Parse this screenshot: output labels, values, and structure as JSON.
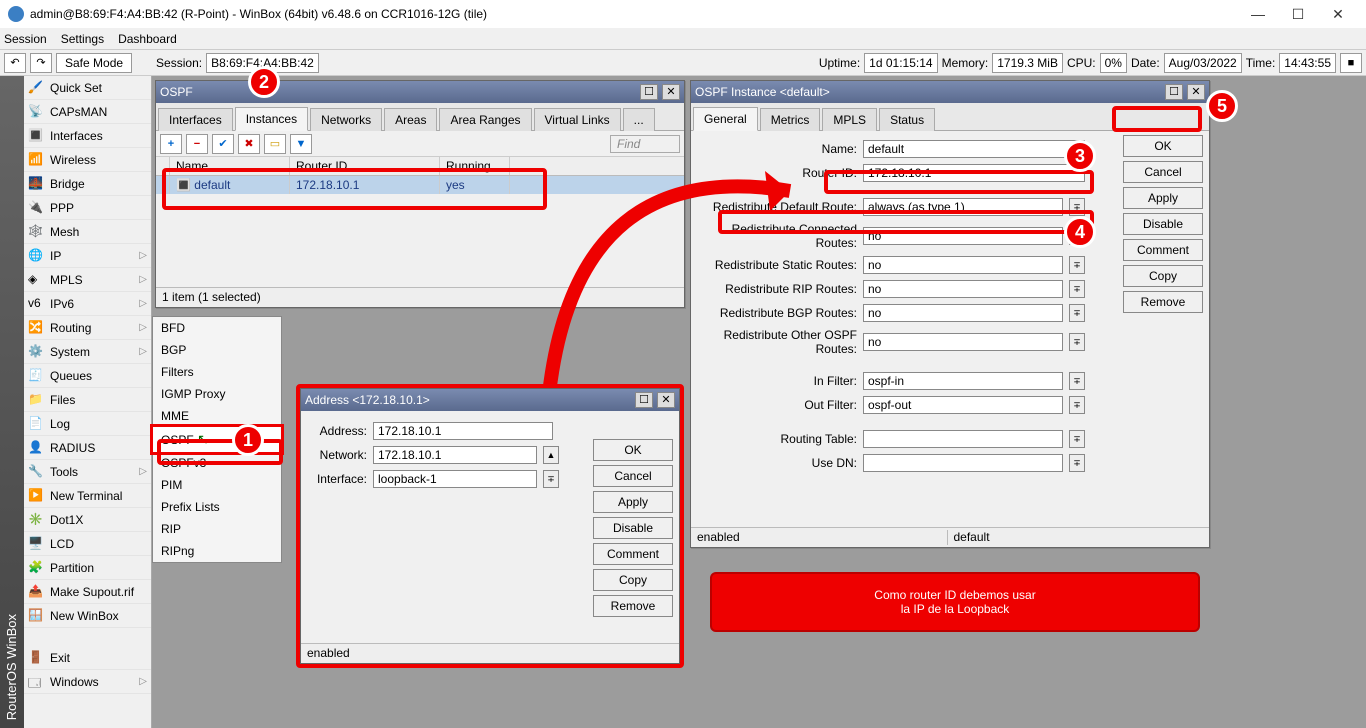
{
  "titlebar": {
    "title": "admin@B8:69:F4:A4:BB:42 (R-Point) - WinBox (64bit) v6.48.6 on CCR1016-12G (tile)"
  },
  "menubar": {
    "items": [
      "Session",
      "Settings",
      "Dashboard"
    ]
  },
  "toolbar": {
    "safe_mode": "Safe Mode",
    "session_label": "Session:",
    "session_value": "B8:69:F4:A4:BB:42",
    "uptime_label": "Uptime:",
    "uptime_value": "1d 01:15:14",
    "memory_label": "Memory:",
    "memory_value": "1719.3 MiB",
    "cpu_label": "CPU:",
    "cpu_value": "0%",
    "date_label": "Date:",
    "date_value": "Aug/03/2022",
    "time_label": "Time:",
    "time_value": "14:43:55"
  },
  "vbar_text": "RouterOS WinBox",
  "sidebar": {
    "items": [
      {
        "label": "Quick Set",
        "icon": "🖌️"
      },
      {
        "label": "CAPsMAN",
        "icon": "📡"
      },
      {
        "label": "Interfaces",
        "icon": "🔳"
      },
      {
        "label": "Wireless",
        "icon": "📶"
      },
      {
        "label": "Bridge",
        "icon": "🌉"
      },
      {
        "label": "PPP",
        "icon": "🔌"
      },
      {
        "label": "Mesh",
        "icon": "🕸️"
      },
      {
        "label": "IP",
        "icon": "🌐",
        "arrow": true
      },
      {
        "label": "MPLS",
        "icon": "◈",
        "arrow": true
      },
      {
        "label": "IPv6",
        "icon": "v6",
        "arrow": true
      },
      {
        "label": "Routing",
        "icon": "🔀",
        "arrow": true
      },
      {
        "label": "System",
        "icon": "⚙️",
        "arrow": true
      },
      {
        "label": "Queues",
        "icon": "🧾"
      },
      {
        "label": "Files",
        "icon": "📁"
      },
      {
        "label": "Log",
        "icon": "📄"
      },
      {
        "label": "RADIUS",
        "icon": "👤"
      },
      {
        "label": "Tools",
        "icon": "🔧",
        "arrow": true
      },
      {
        "label": "New Terminal",
        "icon": "▶️"
      },
      {
        "label": "Dot1X",
        "icon": "✳️"
      },
      {
        "label": "LCD",
        "icon": "🖥️"
      },
      {
        "label": "Partition",
        "icon": "🧩"
      },
      {
        "label": "Make Supout.rif",
        "icon": "📤"
      },
      {
        "label": "New WinBox",
        "icon": "🪟"
      },
      {
        "label": "Exit",
        "icon": "🚪"
      },
      {
        "label": "Windows",
        "icon": "🗔",
        "arrow": true
      }
    ]
  },
  "submenu": {
    "items": [
      "BFD",
      "BGP",
      "Filters",
      "IGMP Proxy",
      "MME",
      "OSPF",
      "OSPFv3",
      "PIM",
      "Prefix Lists",
      "RIP",
      "RIPng"
    ]
  },
  "ospf_window": {
    "title": "OSPF",
    "tabs": [
      "Interfaces",
      "Instances",
      "Networks",
      "Areas",
      "Area Ranges",
      "Virtual Links",
      "..."
    ],
    "find_placeholder": "Find",
    "columns": [
      "Name",
      "Router ID",
      "Running"
    ],
    "row": {
      "name": "default",
      "router_id": "172.18.10.1",
      "running": "yes"
    },
    "status": "1 item (1 selected)"
  },
  "addr_window": {
    "title": "Address <172.18.10.1>",
    "address_label": "Address:",
    "address_value": "172.18.10.1",
    "network_label": "Network:",
    "network_value": "172.18.10.1",
    "interface_label": "Interface:",
    "interface_value": "loopback-1",
    "buttons": [
      "OK",
      "Cancel",
      "Apply",
      "Disable",
      "Comment",
      "Copy",
      "Remove"
    ],
    "status": "enabled"
  },
  "instance_window": {
    "title": "OSPF Instance <default>",
    "tabs": [
      "General",
      "Metrics",
      "MPLS",
      "Status"
    ],
    "fields": {
      "name_label": "Name:",
      "name_value": "default",
      "router_id_label": "Router ID:",
      "router_id_value": "172.18.10.1",
      "redist_default_label": "Redistribute Default Route:",
      "redist_default_value": "always (as type 1)",
      "redist_conn_label": "Redistribute Connected Routes:",
      "redist_conn_value": "no",
      "redist_static_label": "Redistribute Static Routes:",
      "redist_static_value": "no",
      "redist_rip_label": "Redistribute RIP Routes:",
      "redist_rip_value": "no",
      "redist_bgp_label": "Redistribute BGP Routes:",
      "redist_bgp_value": "no",
      "redist_other_label": "Redistribute Other OSPF Routes:",
      "redist_other_value": "no",
      "in_filter_label": "In Filter:",
      "in_filter_value": "ospf-in",
      "out_filter_label": "Out Filter:",
      "out_filter_value": "ospf-out",
      "routing_table_label": "Routing Table:",
      "routing_table_value": "",
      "use_dn_label": "Use DN:",
      "use_dn_value": ""
    },
    "buttons": [
      "OK",
      "Cancel",
      "Apply",
      "Disable",
      "Comment",
      "Copy",
      "Remove"
    ],
    "status_left": "enabled",
    "status_right": "default"
  },
  "callout_text_line1": "Como router ID debemos usar",
  "callout_text_line2": "la IP de la Loopback",
  "markers": [
    "1",
    "2",
    "3",
    "4",
    "5"
  ]
}
